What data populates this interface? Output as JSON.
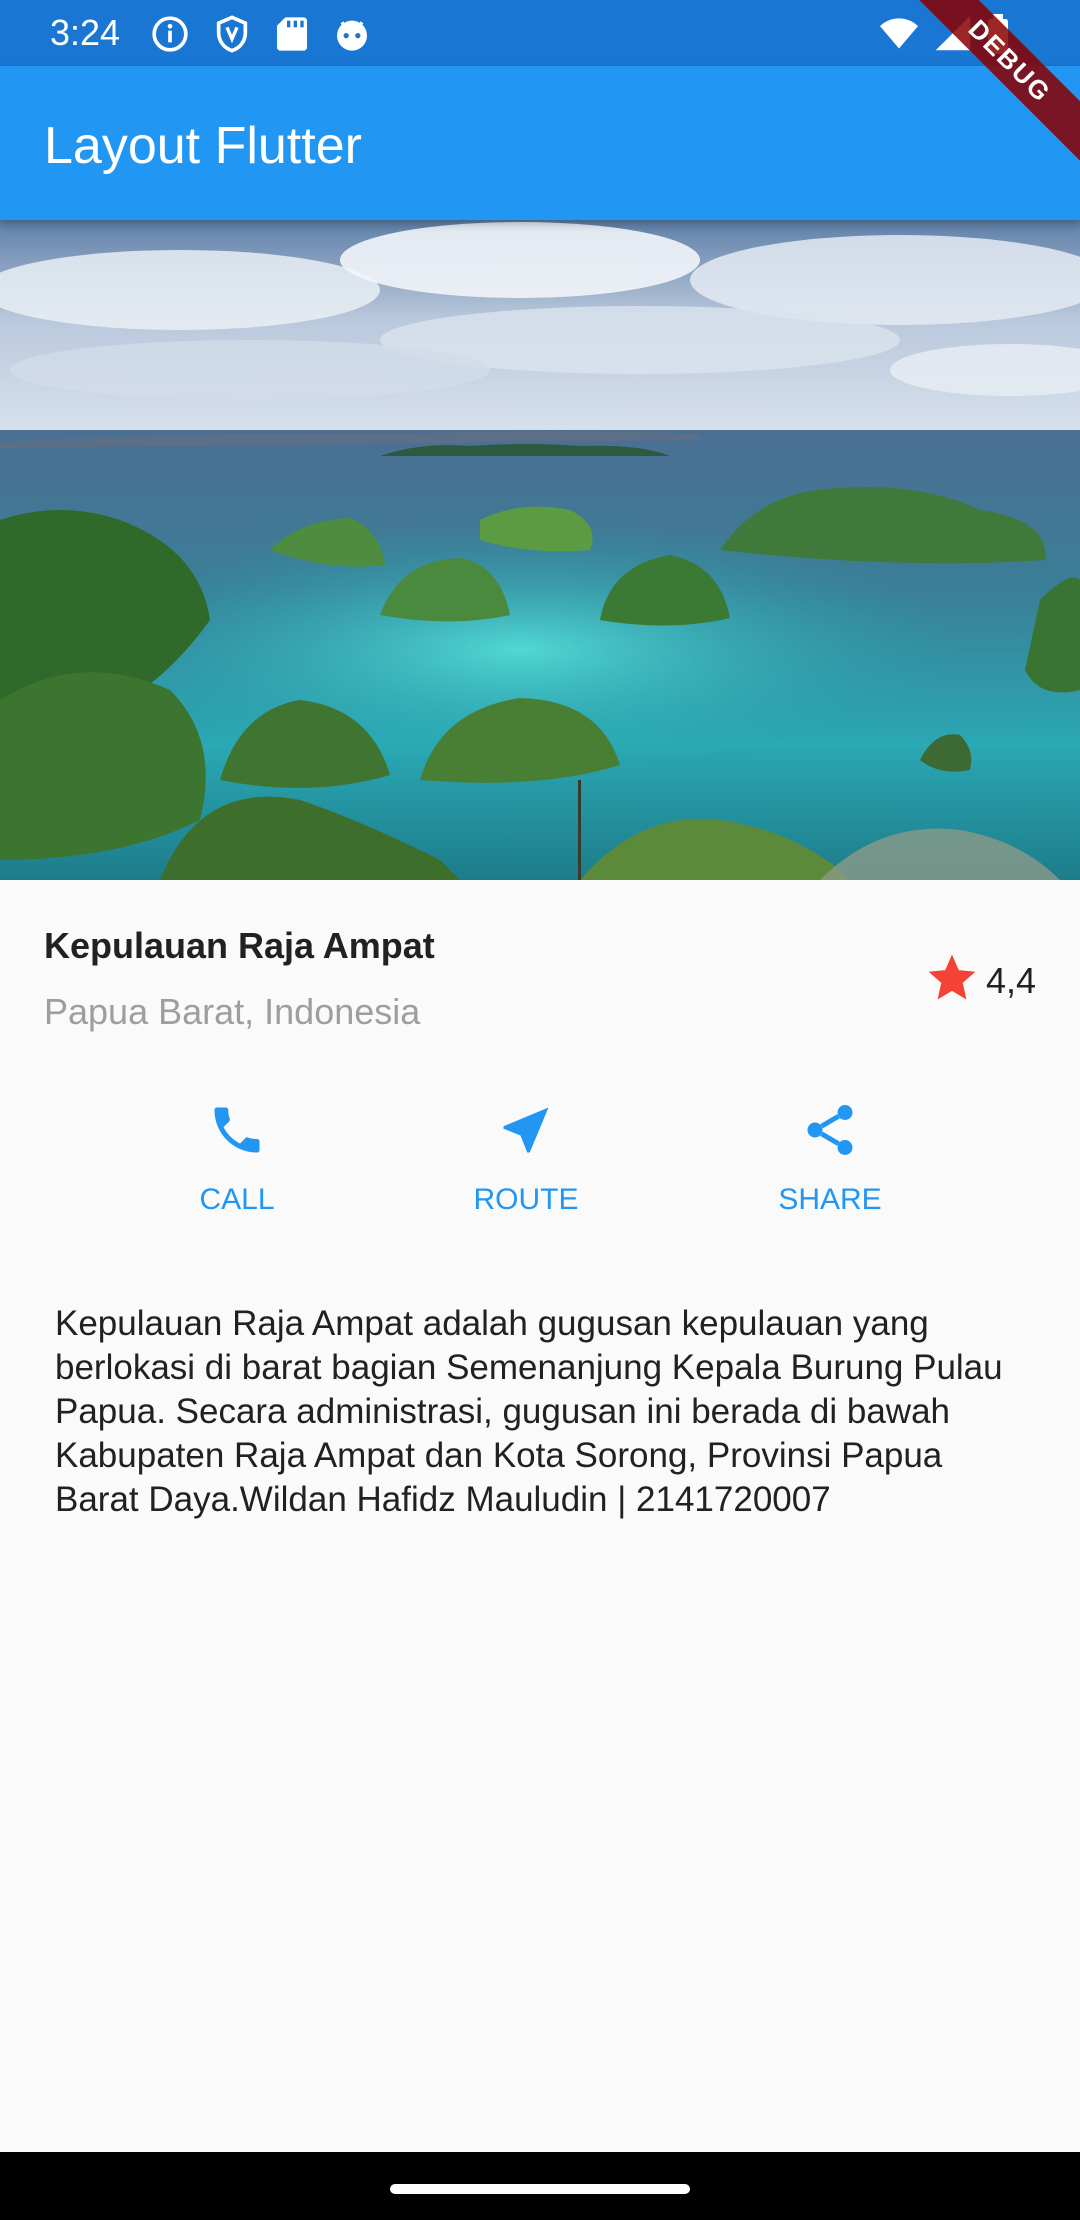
{
  "status_bar": {
    "time": "3:24",
    "left_icons": [
      "info-icon",
      "shield-icon",
      "sd-card-icon",
      "android-face-icon"
    ],
    "right_icons": [
      "wifi-icon",
      "signal-icon",
      "battery-icon"
    ]
  },
  "debug_banner": {
    "label": "DEBUG"
  },
  "app_bar": {
    "title": "Layout Flutter",
    "color": "#2196f3"
  },
  "hero": {
    "alt": "landscape-photo"
  },
  "title_section": {
    "name": "Kepulauan Raja Ampat",
    "location": "Papua Barat, Indonesia",
    "rating": "4,4",
    "star_color": "#f44336"
  },
  "buttons": [
    {
      "label": "CALL",
      "icon": "phone-icon"
    },
    {
      "label": "ROUTE",
      "icon": "navigation-icon"
    },
    {
      "label": "SHARE",
      "icon": "share-icon"
    }
  ],
  "description": "Kepulauan Raja Ampat adalah gugusan kepulauan yang berlokasi di barat bagian Semenanjung Kepala Burung Pulau Papua. Secara administrasi, gugusan ini berada di bawah Kabupaten Raja Ampat dan Kota Sorong, Provinsi Papua Barat Daya.Wildan Hafidz Mauludin | 2141720007",
  "accent_color": "#2196f3"
}
